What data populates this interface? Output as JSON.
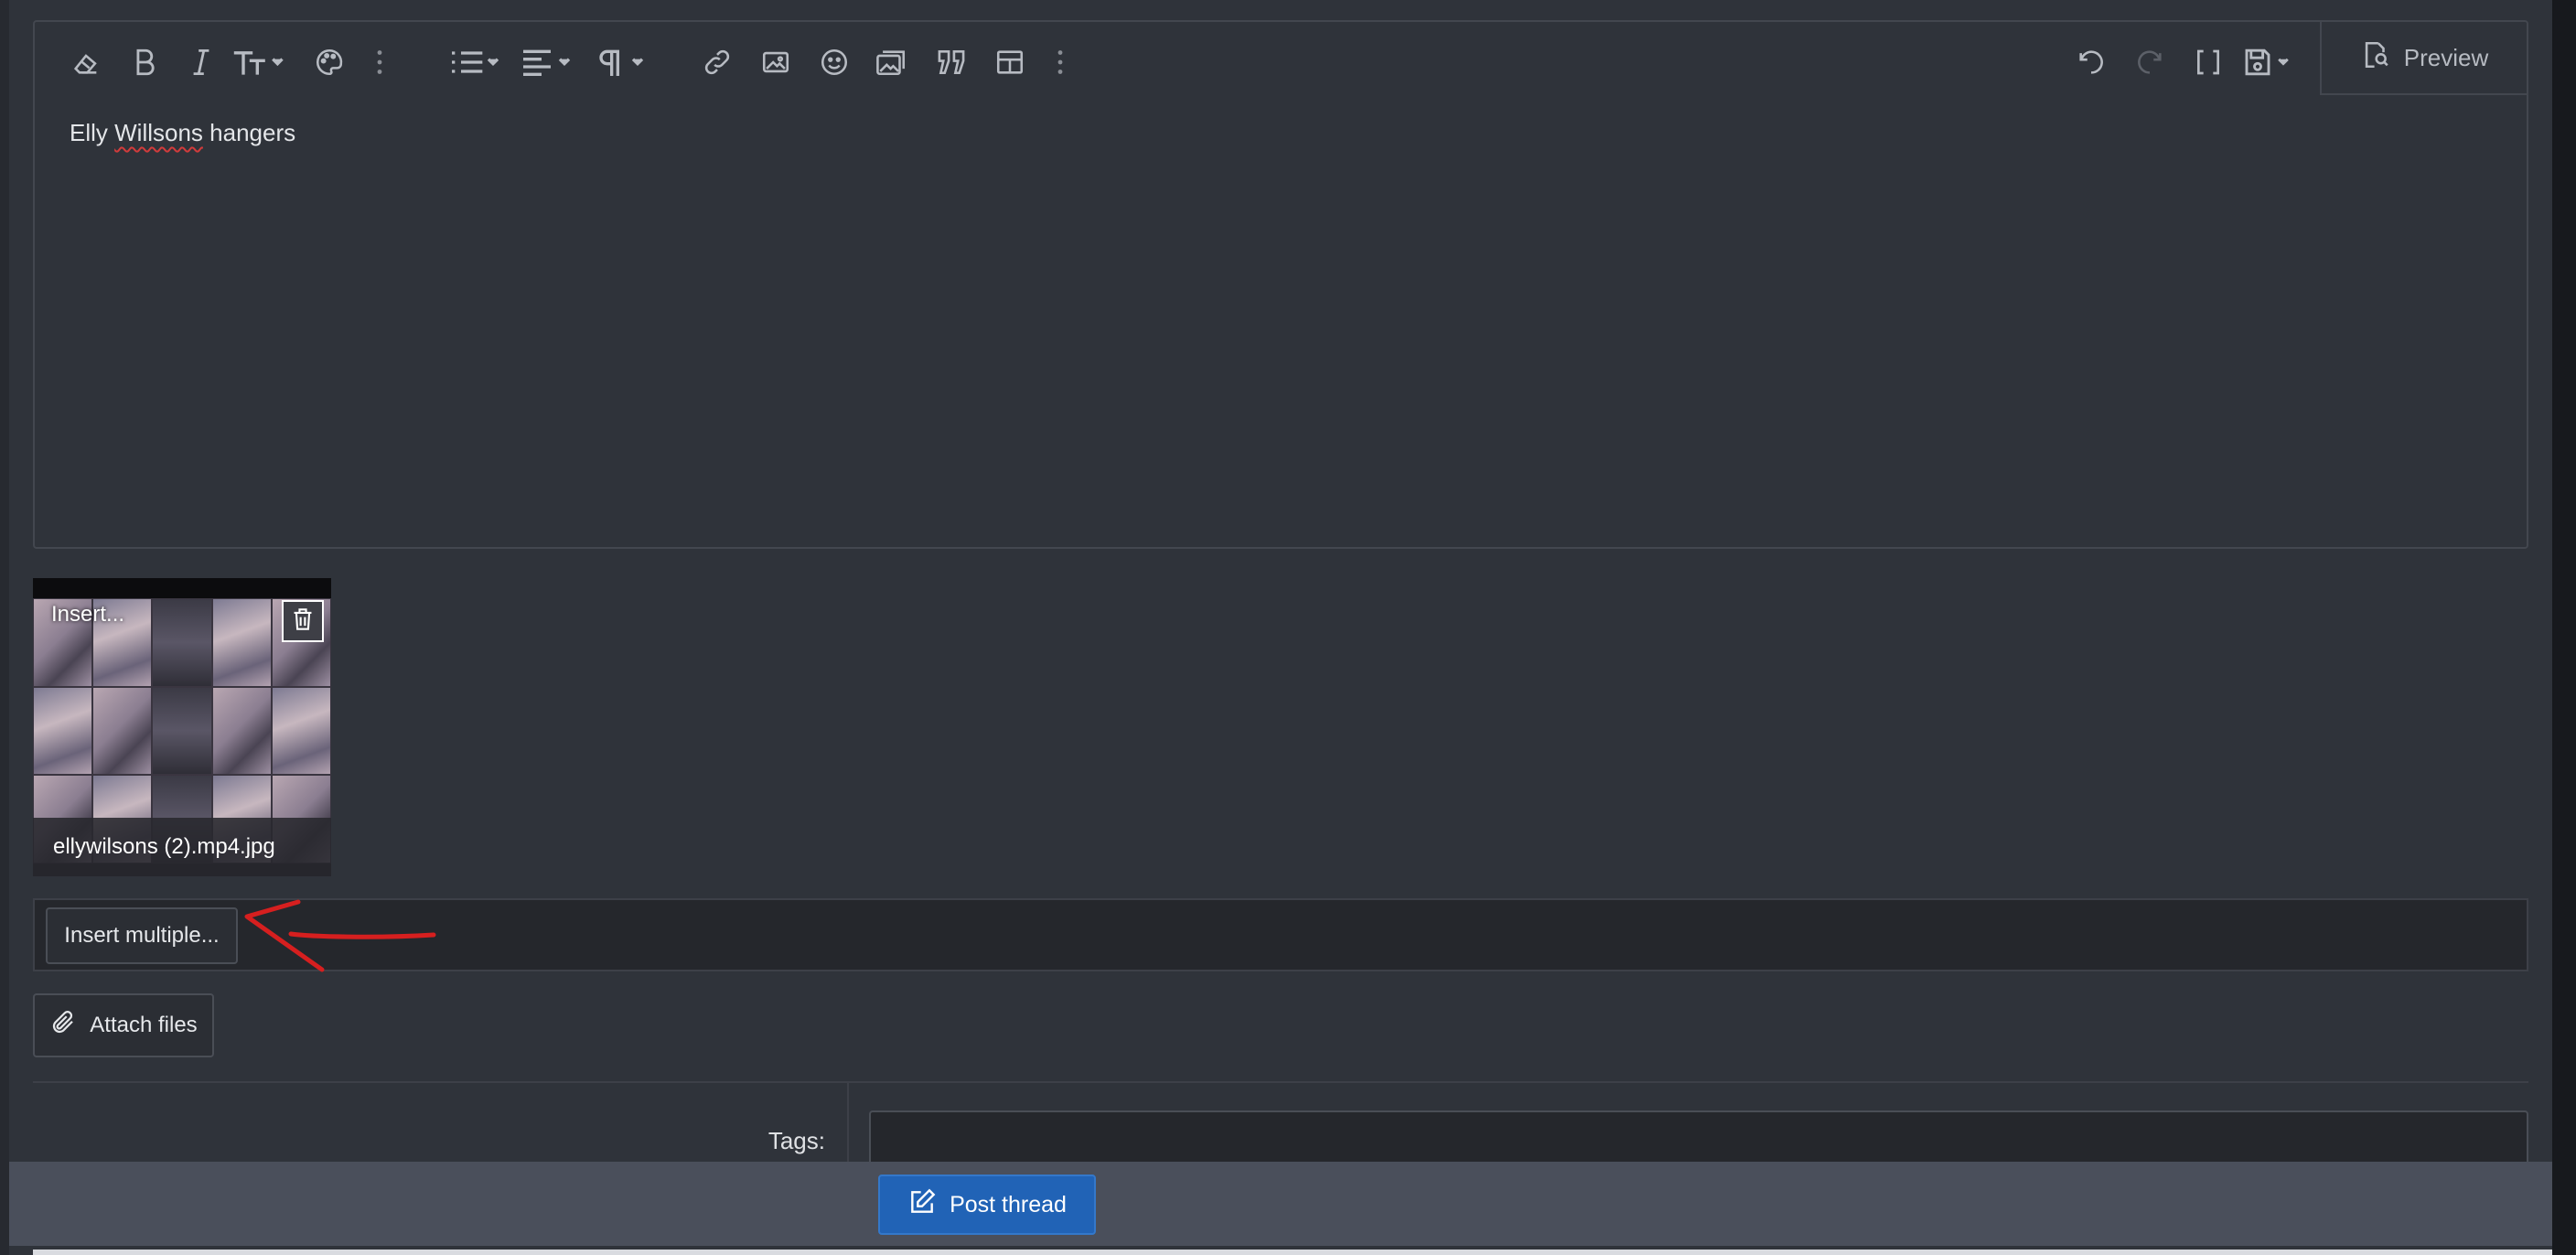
{
  "toolbar": {
    "buttons": [
      {
        "name": "eraser-icon"
      },
      {
        "name": "bold-icon"
      },
      {
        "name": "italic-icon"
      },
      {
        "name": "text-size-icon"
      },
      {
        "name": "palette-icon"
      },
      {
        "name": "more-vertical-icon"
      },
      {
        "name": "list-icon"
      },
      {
        "name": "align-icon"
      },
      {
        "name": "paragraph-icon"
      },
      {
        "name": "link-icon"
      },
      {
        "name": "image-icon"
      },
      {
        "name": "emoji-icon"
      },
      {
        "name": "media-icon"
      },
      {
        "name": "quote-icon"
      },
      {
        "name": "table-icon"
      },
      {
        "name": "more-vertical-icon"
      },
      {
        "name": "undo-icon"
      },
      {
        "name": "redo-icon"
      },
      {
        "name": "brackets-icon"
      },
      {
        "name": "save-draft-icon"
      }
    ],
    "preview_label": "Preview"
  },
  "editor": {
    "content_before": "Elly ",
    "content_misspelled": "Willsons",
    "content_after": " hangers"
  },
  "attachment": {
    "insert_label": "Insert...",
    "filename": "ellywilsons (2).mp4.jpg"
  },
  "insert_bar": {
    "insert_multiple_label": "Insert multiple..."
  },
  "attach": {
    "label": "Attach files"
  },
  "tags": {
    "label": "Tags:",
    "value": ""
  },
  "footer": {
    "post_label": "Post thread"
  },
  "colors": {
    "background": "#2f333a",
    "primary_button": "#2163b6",
    "annotation": "#d61f1f"
  }
}
